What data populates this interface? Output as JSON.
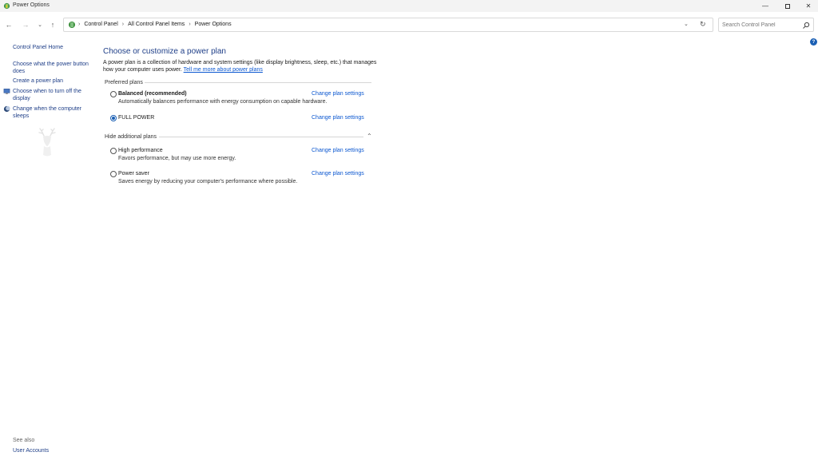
{
  "window": {
    "title": "Power Options"
  },
  "address": {
    "crumbs": [
      "Control Panel",
      "All Control Panel Items",
      "Power Options"
    ]
  },
  "search": {
    "placeholder": "Search Control Panel"
  },
  "sidebar": {
    "home": "Control Panel Home",
    "items": [
      "Choose what the power button does",
      "Create a power plan",
      "Choose when to turn off the display",
      "Change when the computer sleeps"
    ],
    "see_also_label": "See also",
    "see_also_items": [
      "User Accounts"
    ]
  },
  "main": {
    "heading": "Choose or customize a power plan",
    "intro_text": "A power plan is a collection of hardware and system settings (like display brightness, sleep, etc.) that manages how your computer uses power.",
    "intro_link": "Tell me more about power plans",
    "preferred_label": "Preferred plans",
    "additional_label": "Hide additional plans",
    "change_link": "Change plan settings",
    "plans": [
      {
        "name": "Balanced (recommended)",
        "desc": "Automatically balances performance with energy consumption on capable hardware.",
        "selected": false
      },
      {
        "name": "FULL POWER",
        "desc": "",
        "selected": true
      },
      {
        "name": "High performance",
        "desc": "Favors performance, but may use more energy.",
        "selected": false
      },
      {
        "name": "Power saver",
        "desc": "Saves energy by reducing your computer's performance where possible.",
        "selected": false
      }
    ]
  },
  "help": {
    "label": "?"
  },
  "colors": {
    "link": "#1f3f88",
    "accent": "#1a5fb4"
  }
}
